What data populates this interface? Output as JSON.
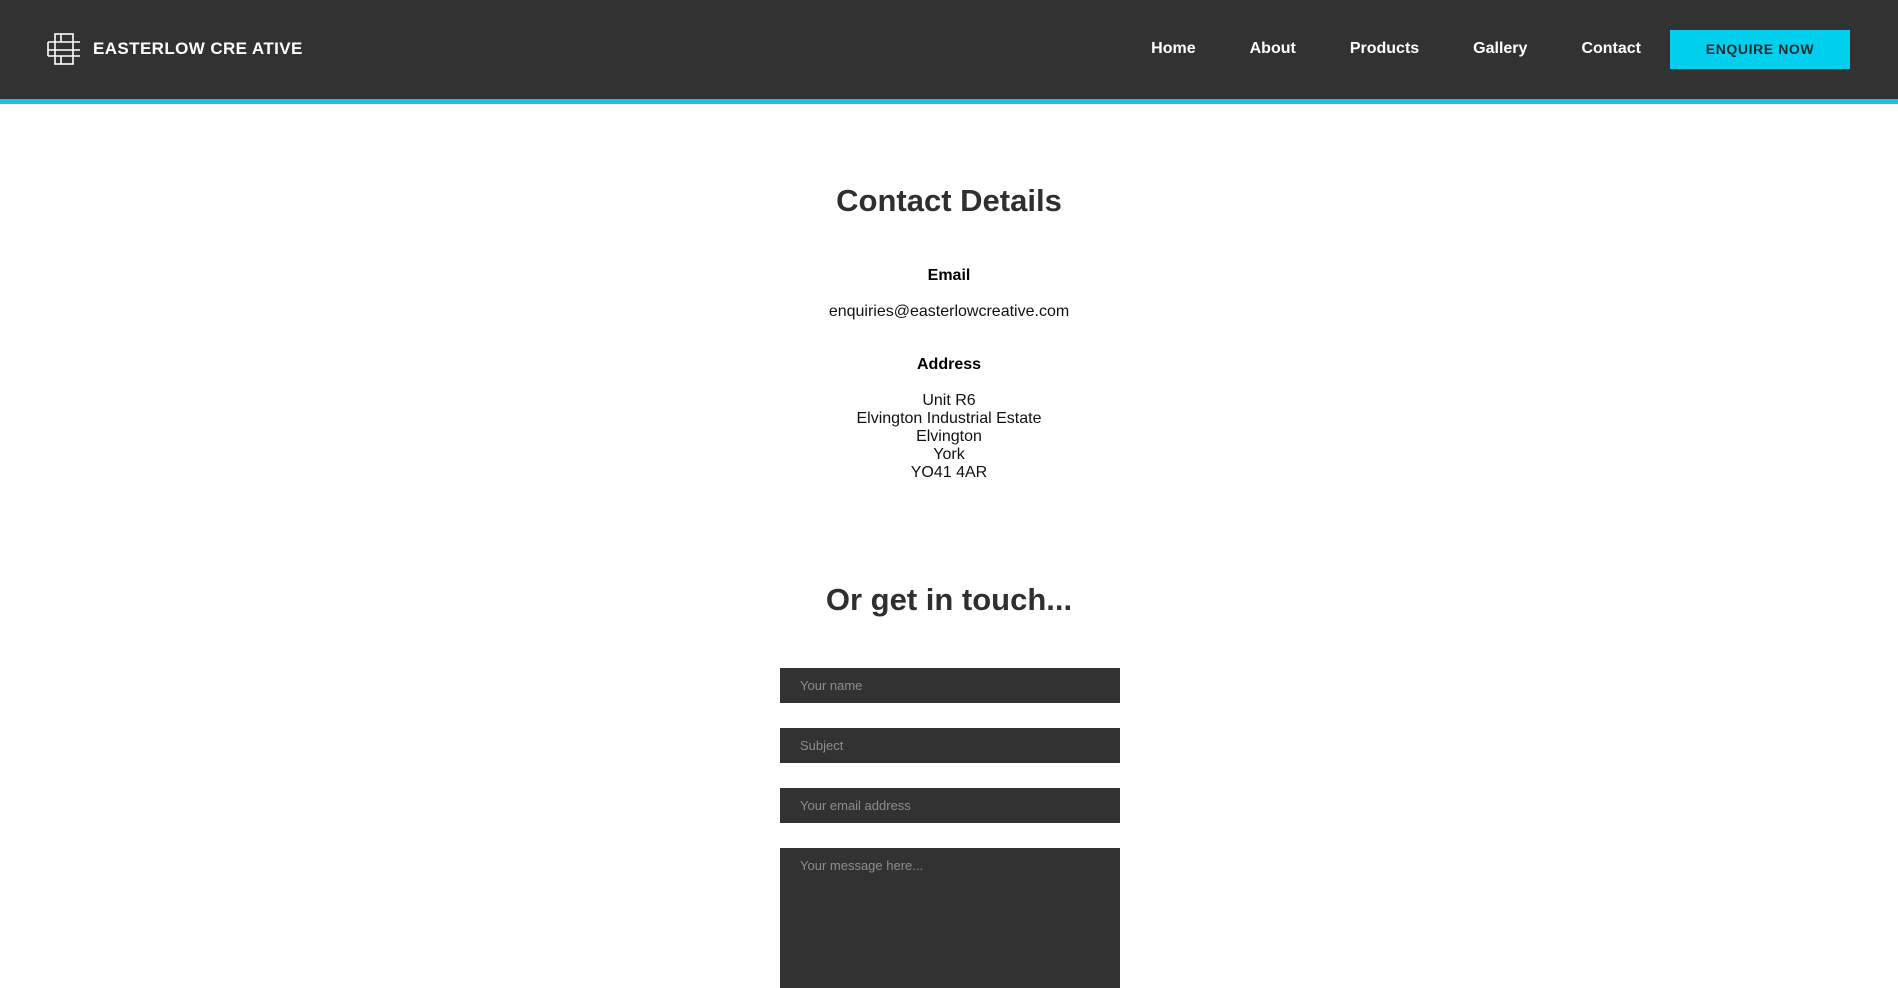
{
  "header": {
    "logo_text": "EASTERLOW CRE ATIVE",
    "logo_icon": "easterlow-monogram-icon",
    "nav": {
      "home": "Home",
      "about": "About",
      "products": "Products",
      "gallery": "Gallery",
      "contact": "Contact"
    },
    "cta_label": "ENQUIRE NOW",
    "accent_color": "#16c3e6",
    "background_color": "#323232"
  },
  "contact": {
    "title": "Contact Details",
    "email_label": "Email",
    "email_value": "enquiries@easterlowcreative.com",
    "address_label": "Address",
    "address_lines": [
      "Unit R6",
      "Elvington Industrial Estate",
      "Elvington",
      "York",
      "YO41 4AR"
    ]
  },
  "form": {
    "title": "Or get in touch...",
    "name_placeholder": "Your name",
    "subject_placeholder": "Subject",
    "email_placeholder": "Your email address",
    "message_placeholder": "Your message here..."
  }
}
